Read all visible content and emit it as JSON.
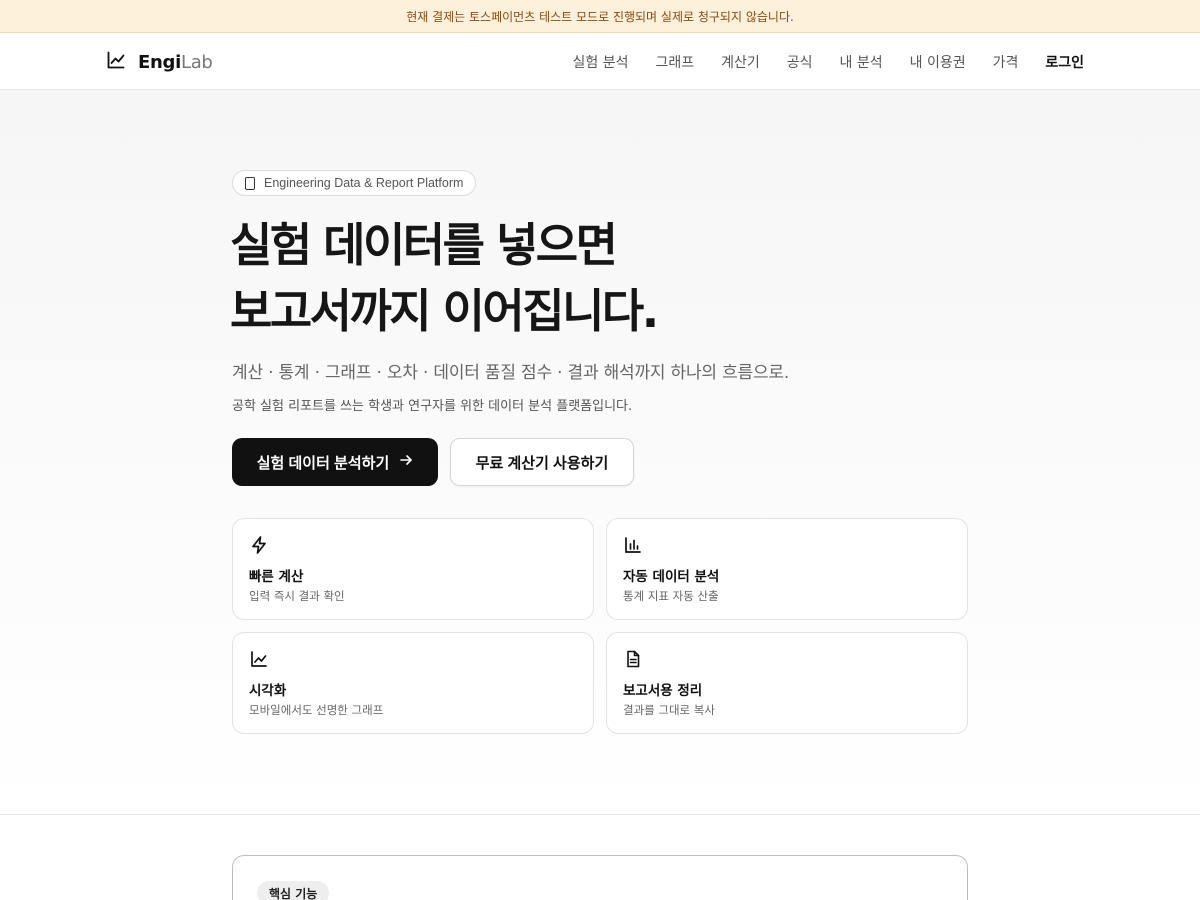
{
  "banner": {
    "text": "현재 결제는 토스페이먼츠 테스트 모드로 진행되며 실제로 청구되지 않습니다."
  },
  "header": {
    "logo_bold": "Engi",
    "logo_light": "Lab",
    "logo_icon": "line-chart-icon",
    "nav": [
      {
        "label": "실험 분석"
      },
      {
        "label": "그래프"
      },
      {
        "label": "계산기"
      },
      {
        "label": "공식"
      },
      {
        "label": "내 분석"
      },
      {
        "label": "내 이용권"
      },
      {
        "label": "가격"
      },
      {
        "label": "로그인"
      }
    ]
  },
  "hero": {
    "pill": "Engineering Data & Report Platform",
    "pill_icon": "device-icon",
    "title_line1": "실험 데이터를 넣으면",
    "title_line2": "보고서까지 이어집니다.",
    "subtitle": "계산 · 통계 · 그래프 · 오차 · 데이터 품질 점수 · 결과 해석까지 하나의 흐름으로.",
    "description": "공학 실험 리포트를 쓰는 학생과 연구자를 위한 데이터 분석 플랫폼입니다.",
    "primary_button": "실험 데이터 분석하기",
    "primary_button_icon": "arrow-right-icon",
    "secondary_button": "무료 계산기 사용하기"
  },
  "features": [
    {
      "icon": "lightning-icon",
      "title": "빠른 계산",
      "desc": "입력 즉시 결과 확인"
    },
    {
      "icon": "bar-chart-icon",
      "title": "자동 데이터 분석",
      "desc": "통계 지표 자동 산출"
    },
    {
      "icon": "line-chart-icon",
      "title": "시각화",
      "desc": "모바일에서도 선명한 그래프"
    },
    {
      "icon": "document-icon",
      "title": "보고서용 정리",
      "desc": "결과를 그대로 복사"
    }
  ],
  "core_section": {
    "badge": "핵심 기능"
  },
  "colors": {
    "banner_bg": "#fdf1dc",
    "banner_text": "#8a4a12",
    "primary": "#111111"
  }
}
